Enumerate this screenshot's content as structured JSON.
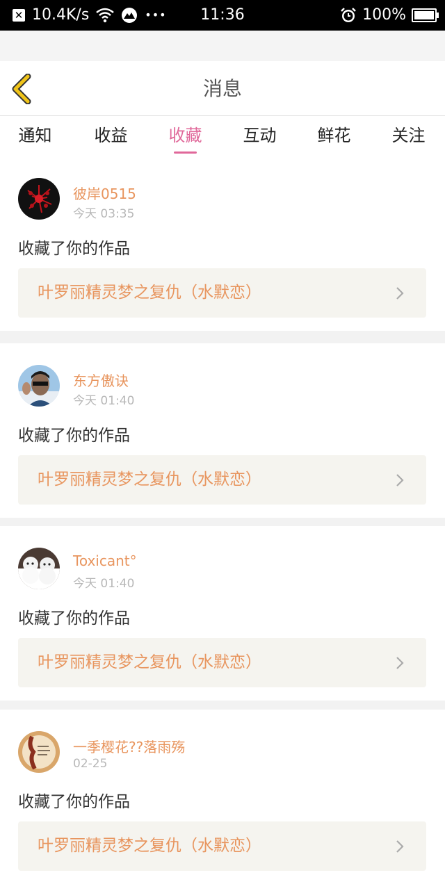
{
  "status_bar": {
    "notif_icon": "x-box-icon",
    "speed": "10.4K/s",
    "more": "•••",
    "time": "11:36",
    "battery": "100%"
  },
  "header": {
    "title": "消息"
  },
  "tabs": [
    {
      "label": "通知",
      "active": false
    },
    {
      "label": "收益",
      "active": false
    },
    {
      "label": "收藏",
      "active": true
    },
    {
      "label": "互动",
      "active": false
    },
    {
      "label": "鲜花",
      "active": false
    },
    {
      "label": "关注",
      "active": false
    }
  ],
  "messages": [
    {
      "user": "彼岸0515",
      "time": "今天 03:35",
      "action": "收藏了你的作品",
      "work": "叶罗丽精灵梦之复仇（水默恋）"
    },
    {
      "user": "东方傲诀",
      "time": "今天 01:40",
      "action": "收藏了你的作品",
      "work": "叶罗丽精灵梦之复仇（水默恋）"
    },
    {
      "user": "Toxicant°",
      "time": "今天 01:40",
      "action": "收藏了你的作品",
      "work": "叶罗丽精灵梦之复仇（水默恋）"
    },
    {
      "user": "一季樱花??落雨殇",
      "time": "02-25",
      "action": "收藏了你的作品",
      "work": "叶罗丽精灵梦之复仇（水默恋）"
    }
  ],
  "colors": {
    "accent_pink": "#e0689a",
    "accent_orange": "#e8955e",
    "back_yellow": "#f0c419"
  }
}
